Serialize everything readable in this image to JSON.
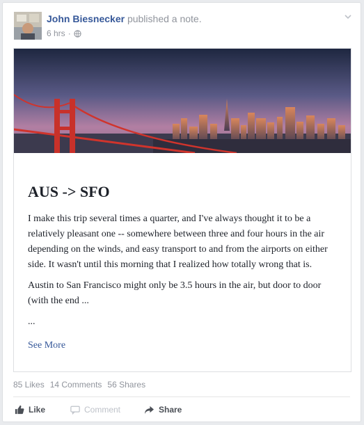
{
  "post": {
    "author": "John Biesnecker",
    "action": "published a note.",
    "time": "6 hrs",
    "privacy_icon": "globe-icon",
    "menu_icon": "chevron-down-icon"
  },
  "note": {
    "cover_alt": "San Francisco skyline with Golden Gate Bridge",
    "title": "AUS -> SFO",
    "paragraphs": [
      "I make this trip several times a quarter, and I've always thought it to be a relatively pleasant one -- somewhere between three and four hours in the air depending on the winds, and easy transport to and from the airports on either side. It wasn't until this morning that I realized how totally wrong that is.",
      "Austin to San Francisco might only be 3.5 hours in the air, but door to door (with the end ...",
      "..."
    ],
    "see_more": "See More"
  },
  "stats": {
    "likes": "85 Likes",
    "comments": "14 Comments",
    "shares": "56 Shares"
  },
  "actions": {
    "like": "Like",
    "comment": "Comment",
    "share": "Share"
  },
  "colors": {
    "link": "#365899",
    "muted": "#90949c",
    "border": "#dddfe2",
    "bridge": "#c0392b"
  }
}
